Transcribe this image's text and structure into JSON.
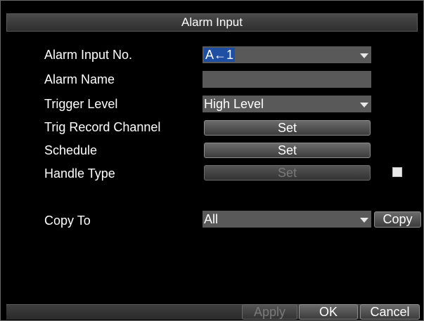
{
  "window": {
    "title": "Alarm Input"
  },
  "form": {
    "alarm_input_no": {
      "label": "Alarm Input No.",
      "value": "A←1"
    },
    "alarm_name": {
      "label": "Alarm Name",
      "value": ""
    },
    "trigger_level": {
      "label": "Trigger Level",
      "value": "High Level"
    },
    "trig_record_channel": {
      "label": "Trig Record Channel",
      "button": "Set"
    },
    "schedule": {
      "label": "Schedule",
      "button": "Set"
    },
    "handle_type": {
      "label": "Handle Type",
      "button": "Set",
      "checkbox_checked": false
    },
    "copy_to": {
      "label": "Copy To",
      "value": "All",
      "button": "Copy"
    }
  },
  "footer": {
    "apply": "Apply",
    "ok": "OK",
    "cancel": "Cancel"
  },
  "icons": {
    "dropdown": "chevron-down-icon",
    "checkbox": "checkbox-icon"
  },
  "colors": {
    "field_bg": "#595959",
    "highlight": "#1f4fa3",
    "background": "#000000"
  }
}
